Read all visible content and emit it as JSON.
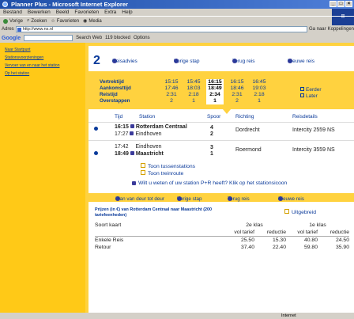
{
  "window": {
    "title": "Planner Plus - Microsoft Internet Explorer",
    "buttons": [
      "_",
      "□",
      "×"
    ]
  },
  "menu": [
    "Bestand",
    "Bewerken",
    "Beeld",
    "Favorieten",
    "Extra",
    "Help"
  ],
  "toolbar": [
    "Vorige",
    "Zoeken",
    "Favorieten",
    "Media"
  ],
  "address": {
    "label": "Adres",
    "value": "http://www.ns.nl",
    "go": "Ga naar",
    "links": "Koppelingen"
  },
  "google": {
    "logo": "Google",
    "search": "Search Web",
    "blocked": "119 blocked",
    "options": "Options"
  },
  "sidebar": [
    "Naar Startpunt",
    "Stationsvoorzieningen",
    "Vervoer van en naar het station",
    "Op het station"
  ],
  "main": {
    "step": "2",
    "nav": [
      "Reisadvies",
      "Vorige stap",
      "Terug reis",
      "Nieuwe reis"
    ],
    "labels": [
      "Vertrektijd",
      "Aankomsttijd",
      "Reistijd",
      "Overstappen"
    ],
    "options": [
      {
        "dep": "15:15",
        "arr": "17:46",
        "dur": "2:31",
        "chg": "2"
      },
      {
        "dep": "15:45",
        "arr": "18:03",
        "dur": "2:18",
        "chg": "1"
      },
      {
        "dep": "16:15",
        "arr": "18:49",
        "dur": "2:34",
        "chg": "1"
      },
      {
        "dep": "16:15",
        "arr": "18:46",
        "dur": "2:31",
        "chg": "2"
      },
      {
        "dep": "16:45",
        "arr": "19:03",
        "dur": "2:18",
        "chg": "1"
      }
    ],
    "earlier": "Eerder",
    "later": "Later",
    "headers": {
      "tijd": "Tijd",
      "station": "Station",
      "spoor": "Spoor",
      "richting": "Richting",
      "reisdetails": "Reisdetails"
    },
    "legs": [
      {
        "t1": "16:15",
        "s1": "Rotterdam Centraal",
        "t2": "17:27",
        "s2": "Eindhoven",
        "p1": "4",
        "p2": "2",
        "dir": "Dordrecht",
        "det": "Intercity 2559 NS"
      },
      {
        "t1": "17:42",
        "s1": "Eindhoven",
        "t2": "18:49",
        "s2": "Maastricht",
        "p1": "3",
        "p2": "1",
        "dir": "Roermond",
        "det": "Intercity 3559 NS"
      }
    ],
    "links": [
      "Toon tussenstations",
      "Toon treinroute"
    ],
    "pr": "Wilt u weten of uw station P+R heeft? Klik op het stationsicoon",
    "bottomnav": [
      "Plan van deur tot deur",
      "Vorige stap",
      "Terug reis",
      "Nieuwe reis"
    ],
    "prices_title": "Prijzen (in €) van Rotterdam Centraal naar Maastricht (200 tariefeenheden)",
    "uitgebreid": "Uitgebreid",
    "table": {
      "soort": "Soort kaart",
      "klas2": "2e klas",
      "klas1": "1e klas",
      "sub": [
        "vol tarief",
        "reductie",
        "vol tarief",
        "reductie"
      ],
      "rows": [
        {
          "name": "Enkele Reis",
          "vals": [
            "25.50",
            "15.30",
            "40.80",
            "24.50"
          ]
        },
        {
          "name": "Retour",
          "vals": [
            "37.40",
            "22.40",
            "59.80",
            "35.90"
          ]
        }
      ]
    }
  },
  "status": {
    "left": "",
    "zone": "Internet"
  }
}
